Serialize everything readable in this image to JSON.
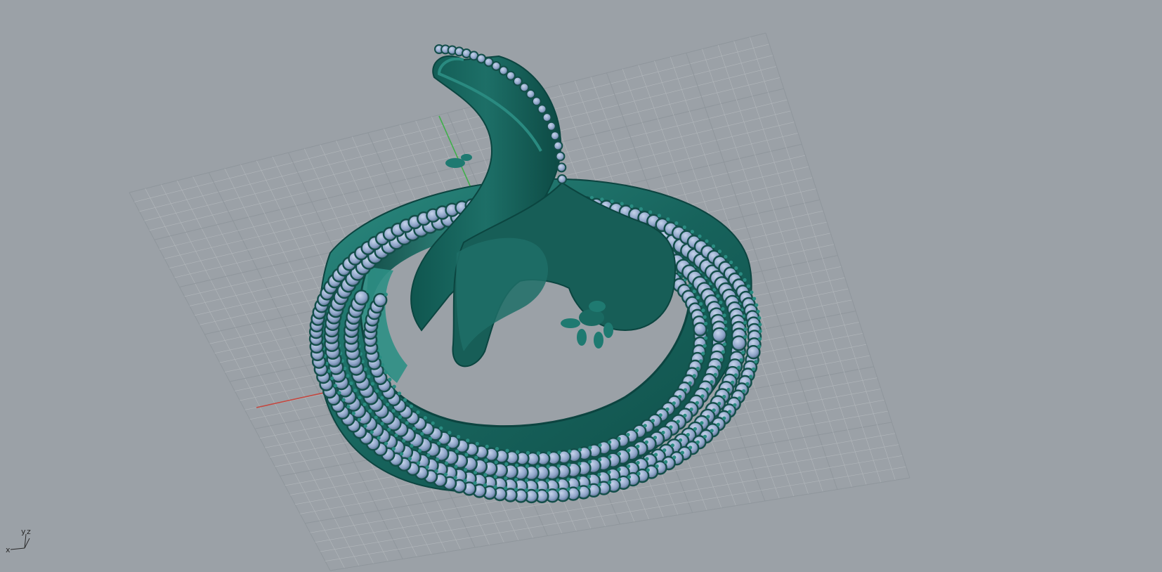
{
  "viewport": {
    "background": "#9ba1a7",
    "model_color": "#1f6e66",
    "gem_color": "#8ea4c8",
    "grid_color": "#b9bec2",
    "x_axis_color": "#c4473f",
    "y_axis_color": "#3fb04a"
  },
  "axes_widget": {
    "x_label": "x",
    "y_label": "y",
    "z_label": "z"
  }
}
